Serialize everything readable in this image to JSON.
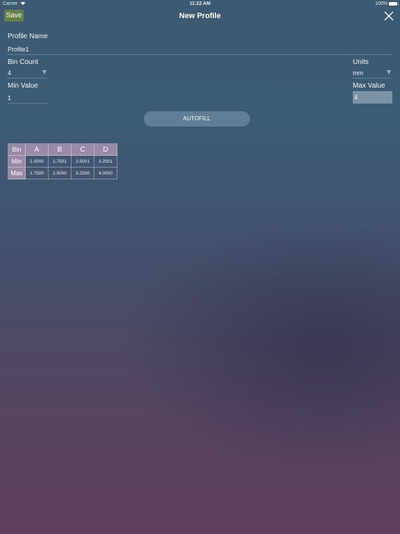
{
  "status_bar": {
    "carrier": "Carrier",
    "time": "11:22 AM",
    "battery": "100%"
  },
  "nav": {
    "save_label": "Save",
    "title": "New Profile"
  },
  "profile_name": {
    "label": "Profile Name",
    "value": "Profile1"
  },
  "bin_count": {
    "label": "Bin Count",
    "value": "4"
  },
  "units": {
    "label": "Units",
    "value": "mm"
  },
  "min_value": {
    "label": "Min Value",
    "value": "1"
  },
  "max_value": {
    "label": "Max Value",
    "value": "4"
  },
  "autofill_label": "AUTOFILL",
  "table": {
    "corner": "Bin",
    "columns": [
      "A",
      "B",
      "C",
      "D"
    ],
    "rows": [
      {
        "label": "Min",
        "values": [
          "1.0000",
          "1.7501",
          "2.5001",
          "3.2501"
        ]
      },
      {
        "label": "Max",
        "values": [
          "1.7500",
          "2.5000",
          "3.2500",
          "4.0000"
        ]
      }
    ]
  },
  "colors": {
    "save_button": "#677e4a",
    "table_header": "#9a8aa6",
    "max_input": "#7b93a6"
  }
}
